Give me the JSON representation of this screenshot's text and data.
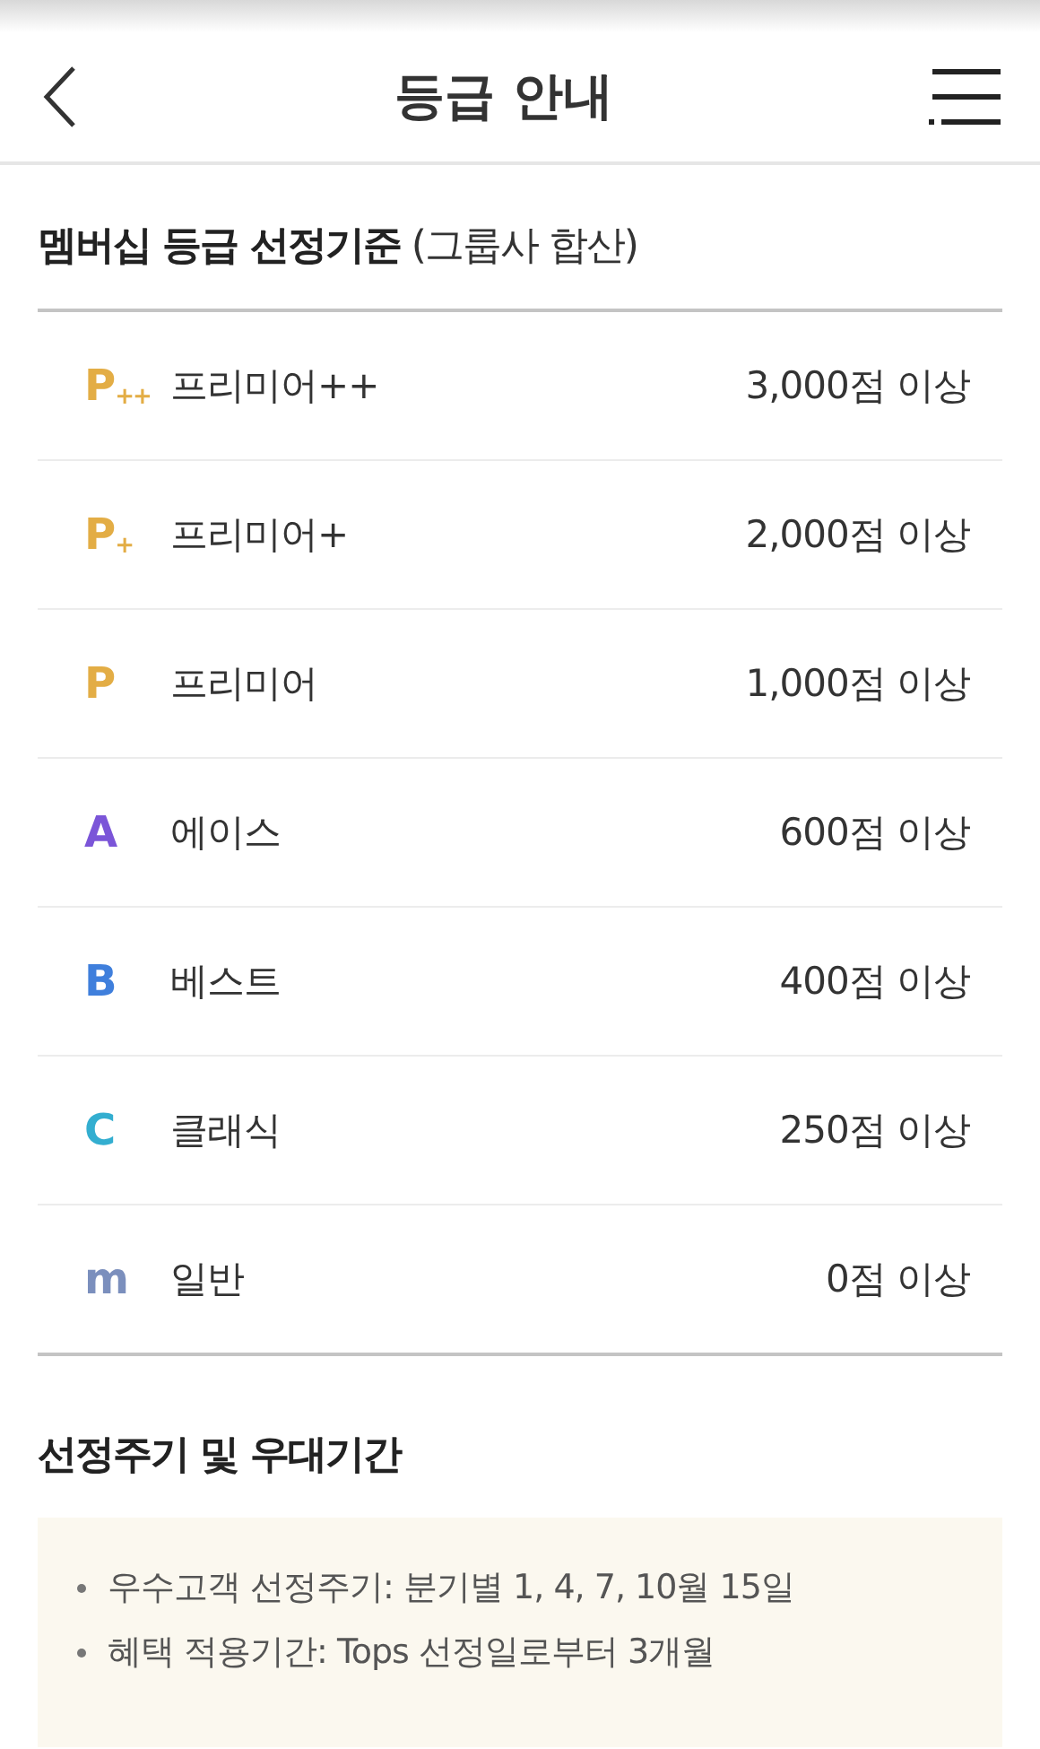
{
  "header": {
    "title": "등급 안내"
  },
  "criteria": {
    "title": "멤버십 등급 선정기준",
    "note": "(그룹사 합산)",
    "grades": [
      {
        "badge": "P$_{++}$",
        "color": "#e3ad45",
        "name": "프리미어++",
        "points": "3,000점 이상"
      },
      {
        "badge": "P$_{+}$",
        "color": "#e3ad45",
        "name": "프리미어+",
        "points": "2,000점 이상"
      },
      {
        "badge": "P",
        "color": "#e3ad45",
        "name": "프리미어",
        "points": "1,000점 이상"
      },
      {
        "badge": "A",
        "color": "#7b55d8",
        "name": "에이스",
        "points": "600점 이상"
      },
      {
        "badge": "B",
        "color": "#3f7fdc",
        "name": "베스트",
        "points": "400점 이상"
      },
      {
        "badge": "C",
        "color": "#33aed0",
        "name": "클래식",
        "points": "250점 이상"
      },
      {
        "badge": "m",
        "color": "#7b8fbd",
        "name": "일반",
        "points": "0점 이상"
      }
    ]
  },
  "period": {
    "title": "선정주기 및 우대기간",
    "items": [
      "우수고객 선정주기: 분기별 1, 4, 7, 10월 15일",
      "혜택 적용기간: Tops 선정일로부터 3개월"
    ]
  }
}
